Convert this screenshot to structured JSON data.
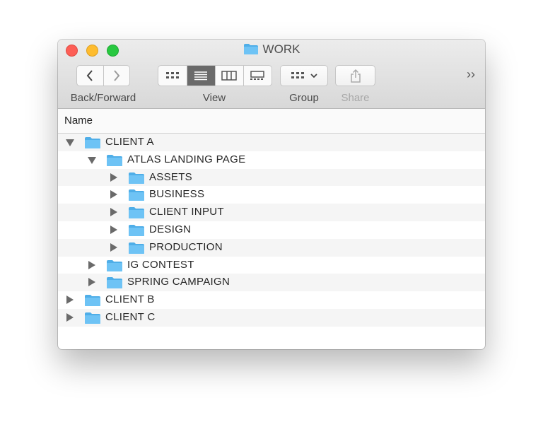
{
  "window": {
    "title": "WORK"
  },
  "toolbar": {
    "back_forward_label": "Back/Forward",
    "view_label": "View",
    "group_label": "Group",
    "share_label": "Share",
    "overflow_glyph": "››"
  },
  "columns": {
    "name": "Name"
  },
  "tree": [
    {
      "label": "CLIENT A",
      "depth": 0,
      "expanded": true
    },
    {
      "label": "ATLAS LANDING PAGE",
      "depth": 1,
      "expanded": true
    },
    {
      "label": "ASSETS",
      "depth": 2,
      "expanded": false
    },
    {
      "label": "BUSINESS",
      "depth": 2,
      "expanded": false
    },
    {
      "label": "CLIENT INPUT",
      "depth": 2,
      "expanded": false
    },
    {
      "label": "DESIGN",
      "depth": 2,
      "expanded": false
    },
    {
      "label": "PRODUCTION",
      "depth": 2,
      "expanded": false
    },
    {
      "label": "IG CONTEST",
      "depth": 1,
      "expanded": false
    },
    {
      "label": "SPRING CAMPAIGN",
      "depth": 1,
      "expanded": false
    },
    {
      "label": "CLIENT B",
      "depth": 0,
      "expanded": false
    },
    {
      "label": "CLIENT C",
      "depth": 0,
      "expanded": false
    }
  ],
  "colors": {
    "folder": "#6ec3f5",
    "folder_tab": "#4faee8",
    "active_view": "#6a6a6a"
  },
  "icons": {
    "folder": "folder-icon",
    "back": "chevron-left-icon",
    "forward": "chevron-right-icon"
  }
}
